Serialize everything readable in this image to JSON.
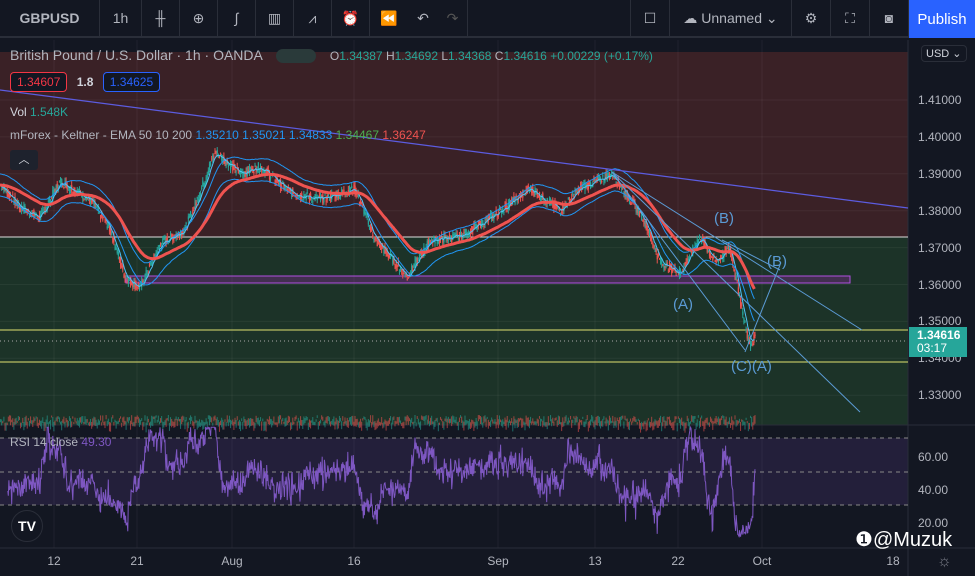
{
  "toolbar": {
    "symbol": "GBPUSD",
    "interval": "1h",
    "layout_name": "Unnamed",
    "publish": "Publish",
    "icons": [
      "candles-icon",
      "add-indicator-icon",
      "fx-icon",
      "bar-chart-icon",
      "compare-icon",
      "alert-icon",
      "replay-icon",
      "undo-icon",
      "redo-icon",
      "square-icon",
      "cloud-icon",
      "gear-icon",
      "fullscreen-icon",
      "camera-icon"
    ]
  },
  "legend": {
    "title": "British Pound / U.S. Dollar · 1h · OANDA",
    "o_label": "O",
    "o": "1.34387",
    "h_label": "H",
    "h": "1.34692",
    "l_label": "L",
    "l": "1.34368",
    "c_label": "C",
    "c": "1.34616",
    "change": "+0.00229 (+0.17%)",
    "sell": "1.34607",
    "spread": "1.8",
    "buy": "1.34625",
    "vol_label": "Vol",
    "vol": "1.548K",
    "indicator": "mForex - Keltner - EMA 50 10 200",
    "ind_values": [
      "1.35210",
      "1.35021",
      "1.34833",
      "1.34467",
      "1.36247"
    ],
    "rsi_label": "RSI 14 close",
    "rsi_value": "49.30"
  },
  "price_axis": {
    "currency": "USD",
    "ticks": [
      "1.41000",
      "1.40000",
      "1.39000",
      "1.38000",
      "1.37000",
      "1.36000",
      "1.35000",
      "1.34000",
      "1.33000"
    ],
    "last_price": "1.34616",
    "countdown": "03:17"
  },
  "rsi_axis": {
    "ticks": [
      "60.00",
      "40.00",
      "20.00"
    ]
  },
  "time_axis": [
    "12",
    "21",
    "Aug",
    "16",
    "Sep",
    "13",
    "22",
    "Oct",
    "18"
  ],
  "wave_labels": [
    "(B)",
    "(B)",
    "(A)",
    "(C)(A)"
  ],
  "watermark": "@Muzuk",
  "colors": {
    "up": "#26a69a",
    "down": "#ef5350",
    "publish": "#2962ff",
    "rsi": "#7e57c2"
  },
  "chart_data": {
    "type": "candlestick",
    "price_range": [
      1.325,
      1.42
    ],
    "rsi_range": [
      10,
      80
    ],
    "keypoints": [
      [
        0,
        1.387
      ],
      [
        36,
        1.381
      ],
      [
        72,
        1.378
      ],
      [
        108,
        1.388
      ],
      [
        162,
        1.383
      ],
      [
        198,
        1.375
      ],
      [
        225,
        1.362
      ],
      [
        252,
        1.359
      ],
      [
        288,
        1.371
      ],
      [
        333,
        1.375
      ],
      [
        360,
        1.385
      ],
      [
        387,
        1.396
      ],
      [
        432,
        1.39
      ],
      [
        468,
        1.392
      ],
      [
        522,
        1.385
      ],
      [
        576,
        1.383
      ],
      [
        639,
        1.386
      ],
      [
        675,
        1.372
      ],
      [
        711,
        1.366
      ],
      [
        733,
        1.362
      ],
      [
        774,
        1.372
      ],
      [
        828,
        1.373
      ],
      [
        882,
        1.378
      ],
      [
        954,
        1.386
      ],
      [
        1008,
        1.38
      ],
      [
        1044,
        1.386
      ],
      [
        1102,
        1.39
      ],
      [
        1134,
        1.383
      ],
      [
        1161,
        1.377
      ],
      [
        1188,
        1.366
      ],
      [
        1224,
        1.363
      ],
      [
        1260,
        1.373
      ],
      [
        1287,
        1.366
      ],
      [
        1314,
        1.37
      ],
      [
        1341,
        1.349
      ],
      [
        1350,
        1.343
      ],
      [
        1359,
        1.346
      ]
    ]
  }
}
